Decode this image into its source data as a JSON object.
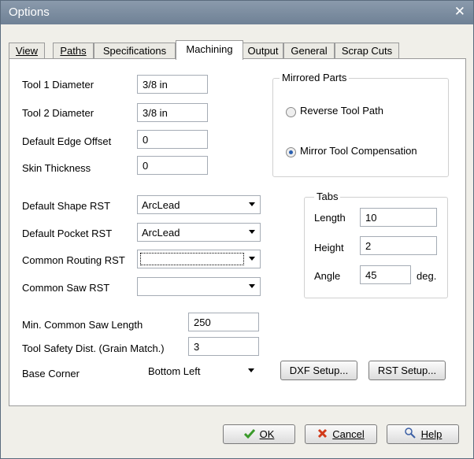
{
  "window": {
    "title": "Options",
    "close_glyph": "✕"
  },
  "tabs": [
    {
      "label": "View"
    },
    {
      "label": "Paths"
    },
    {
      "label": "Specifications"
    },
    {
      "label": "Machining",
      "active": true
    },
    {
      "label": "Output"
    },
    {
      "label": "General"
    },
    {
      "label": "Scrap Cuts"
    }
  ],
  "machining": {
    "tool1_label": "Tool 1 Diameter",
    "tool1_value": "3/8 in",
    "tool2_label": "Tool 2 Diameter",
    "tool2_value": "3/8 in",
    "edge_offset_label": "Default Edge Offset",
    "edge_offset_value": "0",
    "skin_label": "Skin Thickness",
    "skin_value": "0",
    "shape_rst_label": "Default Shape RST",
    "shape_rst_value": "ArcLead",
    "pocket_rst_label": "Default Pocket RST",
    "pocket_rst_value": "ArcLead",
    "common_routing_label": "Common Routing RST",
    "common_routing_value": "",
    "common_saw_label": "Common Saw RST",
    "common_saw_value": "",
    "min_saw_label": "Min. Common Saw Length",
    "min_saw_value": "250",
    "safety_label": "Tool Safety Dist. (Grain Match.)",
    "safety_value": "3",
    "base_corner_label": "Base Corner",
    "base_corner_value": "Bottom Left"
  },
  "mirrored": {
    "title": "Mirrored Parts",
    "options": [
      {
        "label": "Reverse Tool Path",
        "selected": false
      },
      {
        "label": "Mirror Tool Compensation",
        "selected": true
      }
    ]
  },
  "tabs_group": {
    "title": "Tabs",
    "length_label": "Length",
    "length_value": "10",
    "height_label": "Height",
    "height_value": "2",
    "angle_label": "Angle",
    "angle_value": "45",
    "angle_unit": "deg."
  },
  "buttons": {
    "dxf_setup": "DXF Setup...",
    "rst_setup": "RST Setup...",
    "ok": "OK",
    "cancel": "Cancel",
    "help": "Help"
  },
  "icons": {
    "ok": "check-icon",
    "cancel": "x-icon",
    "help": "help-icon"
  },
  "colors": {
    "title_bar": "#7a8ca0",
    "radio_selected": "#2a5fb0",
    "ok_check": "#3a9a2a",
    "cancel_x": "#d23a1a"
  }
}
